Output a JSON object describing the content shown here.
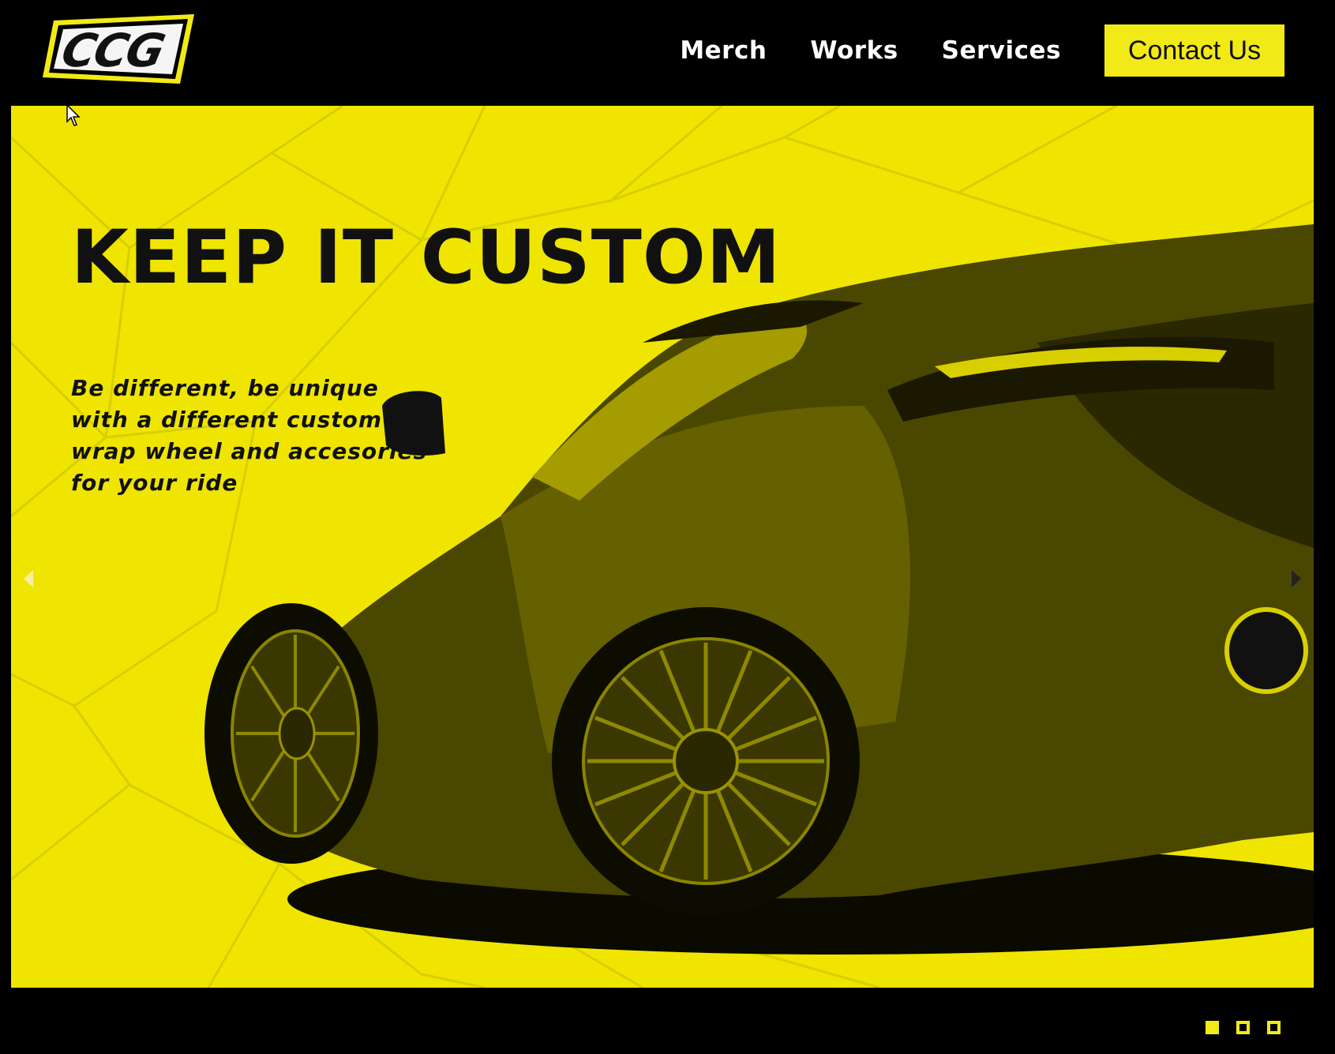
{
  "brand": {
    "logo_text": "CCG"
  },
  "nav": {
    "items": [
      "Merch",
      "Works",
      "Services"
    ],
    "contact_label": "Contact Us"
  },
  "hero": {
    "title": "KEEP IT CUSTOM",
    "description": "Be different, be unique with a different custom car wrap wheel and accesories for your ride",
    "prev_icon": "caret-left-icon",
    "next_icon": "caret-right-icon"
  },
  "carousel": {
    "slide_count": 3,
    "active_slide": 1
  },
  "colors": {
    "accent_yellow": "#f2ea16",
    "hero_yellow": "#efe500",
    "background": "#000000",
    "text_dark": "#111111"
  }
}
